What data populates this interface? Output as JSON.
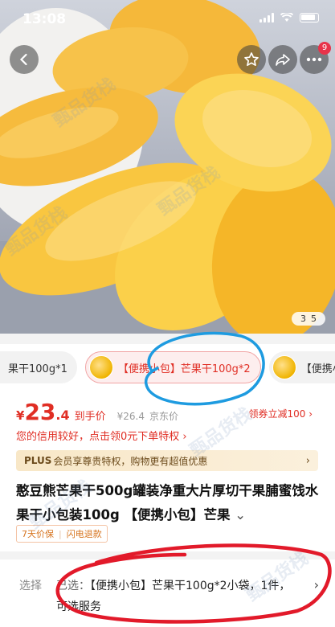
{
  "status_bar": {
    "time": "13:08"
  },
  "nav": {
    "badge_count": "9"
  },
  "gallery": {
    "current": "3",
    "total": "5"
  },
  "variants": [
    {
      "label": "果干100g*1"
    },
    {
      "label": "【便携小包】芒果干100g*2",
      "selected": true
    },
    {
      "label": "【便携小"
    }
  ],
  "price": {
    "currency": "¥",
    "integer": "23",
    "decimal": ".4",
    "tag": "到手价",
    "original": "¥26.4",
    "original_source": "京东价",
    "coupon": "领券立减100 ›"
  },
  "credit_tip": "您的信用较好，点击领0元下单特权 ›",
  "plus_banner": {
    "brand": "PLUS",
    "text": "会员享尊贵特权，购物更有超值优惠",
    "arrow": "›"
  },
  "product": {
    "title": "憨豆熊芒果干500g罐装净重大片厚切干果脯蜜饯水果干小包装100g 【便携小包】芒果",
    "title_more": "⌄"
  },
  "services": [
    "7天价保",
    "闪电退款"
  ],
  "selection": {
    "label": "选择",
    "prefix": "已选：",
    "value": "【便携小包】芒果干100g*2小袋，1件，可选服务",
    "arrow": "›"
  },
  "watermark": "甄品货栈",
  "colors": {
    "accent": "#e02e24",
    "annotation_blue": "#1e9be0",
    "annotation_red": "#e21a2a",
    "plus_text": "#6b4a1b"
  }
}
